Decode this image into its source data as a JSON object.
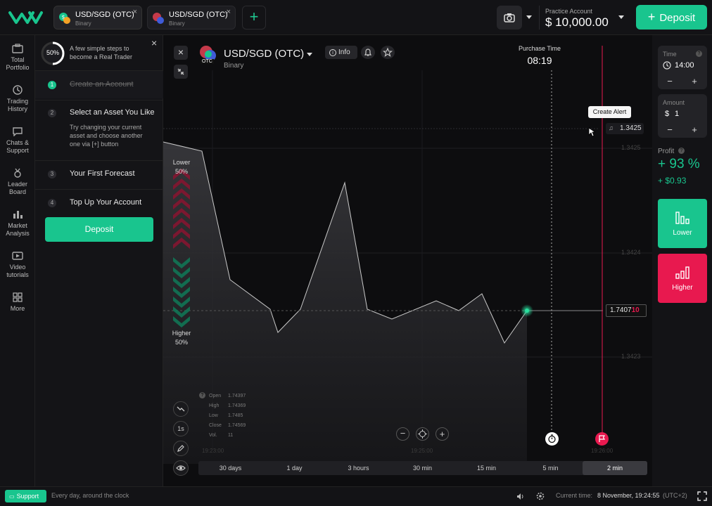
{
  "topbar": {
    "tabs": [
      {
        "asset": "USD/SGD (OTC)",
        "type": "Binary"
      },
      {
        "asset": "USD/SGD (OTC)",
        "type": "Binary"
      }
    ],
    "add_tab": "+",
    "account_label": "Practice Account",
    "balance": "$ 10,000.00",
    "deposit_label": "Deposit"
  },
  "sidenav": [
    {
      "label1": "Total",
      "label2": "Portfolio"
    },
    {
      "label1": "Trading",
      "label2": "History"
    },
    {
      "label1": "Chats &",
      "label2": "Support"
    },
    {
      "label1": "Leader",
      "label2": "Board"
    },
    {
      "label1": "Market",
      "label2": "Analysis"
    },
    {
      "label1": "Video",
      "label2": "tutorials"
    },
    {
      "label1": "More",
      "label2": ""
    }
  ],
  "steps": {
    "progress": "50%",
    "progress_value": 0.5,
    "intro1": "A few simple steps to",
    "intro2": "become a Real Trader",
    "items": [
      {
        "num": "1",
        "title": "Create an Account",
        "done": true
      },
      {
        "num": "2",
        "title": "Select an Asset You Like",
        "desc1": "Try changing your current",
        "desc2": "asset and choose another",
        "desc3": "one via [+] button"
      },
      {
        "num": "3",
        "title": "Your First Forecast"
      },
      {
        "num": "4",
        "title": "Top Up Your Account"
      }
    ],
    "deposit_label": "Deposit"
  },
  "chart": {
    "asset": "USD/SGD (OTC)",
    "asset_type": "Binary",
    "otc_badge": "OTC",
    "info_label": "Info",
    "purchase_label": "Purchase Time",
    "purchase_time": "08:19",
    "create_alert": "Create Alert",
    "alert_price": "1.3425",
    "price_levels": [
      "1.3425",
      "1.3424",
      "1.3423"
    ],
    "current_price_main": "1.7407",
    "current_price_tail": "10",
    "lower_label": "Lower",
    "lower_pct": "50%",
    "higher_label": "Higher",
    "higher_pct": "50%",
    "ohlc": {
      "open_label": "Open",
      "open": "1.74397",
      "high_label": "High",
      "high": "1.74369",
      "low_label": "Low",
      "low": "1.7485",
      "close_label": "Close",
      "close": "1.74569",
      "vol_label": "Vol.",
      "vol": "11"
    },
    "time_ticks": [
      "19:23:00",
      "19:25:00",
      "19:26:00"
    ],
    "timeframes": [
      "30 days",
      "1 day",
      "3 hours",
      "30 min",
      "15 min",
      "5 min",
      "2 min"
    ],
    "active_timeframe": "2 min",
    "tool_1s": "1s"
  },
  "right": {
    "time_label": "Time",
    "time_value": "14:00",
    "amount_label": "Amount",
    "amount_currency": "$",
    "amount_value": "1",
    "profit_label": "Profit",
    "profit_pct": "+ 93 %",
    "profit_amount": "+ $0.93",
    "lower_button": "Lower",
    "higher_button": "Higher",
    "minus": "−",
    "plus": "+"
  },
  "bottombar": {
    "support_label": "Support",
    "support_note": "Every day, around the clock",
    "current_time_label": "Current time:",
    "current_time_value": "8 November, 19:24:55",
    "timezone": "(UTC+2)"
  },
  "colors": {
    "accent": "#19c58e",
    "danger": "#e8194f"
  }
}
